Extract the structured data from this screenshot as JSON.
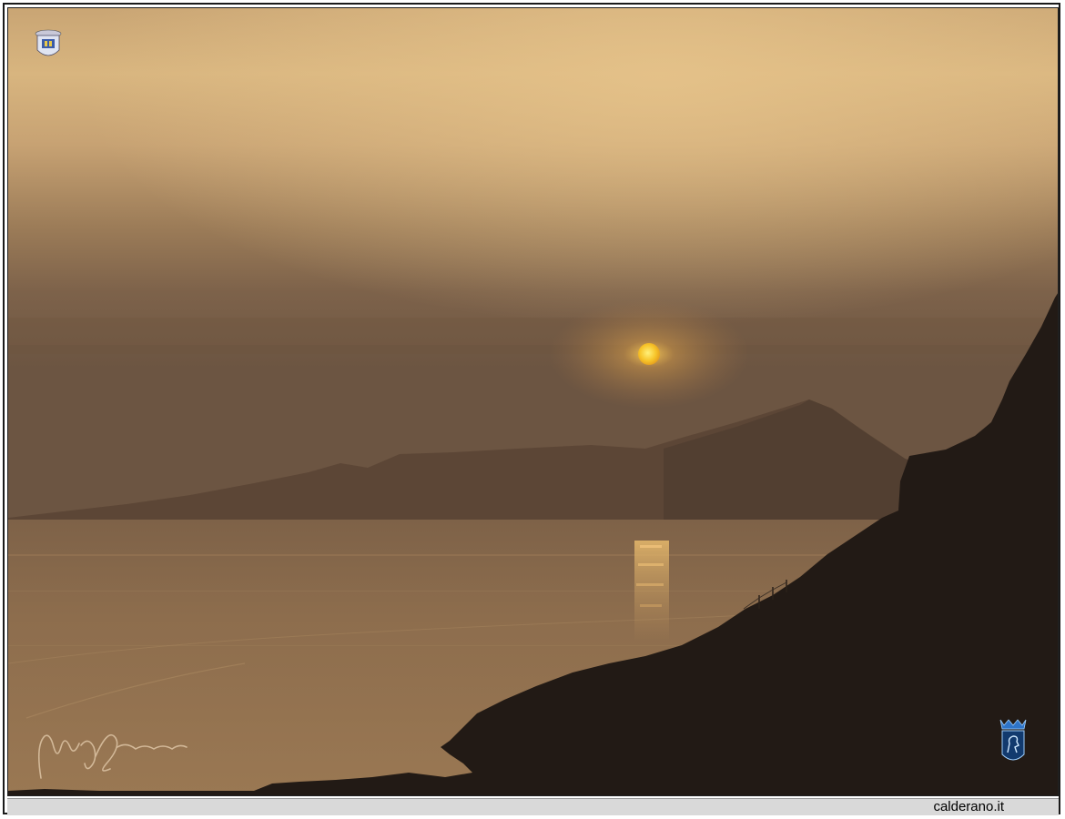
{
  "footer": {
    "site_label": "calderano.it"
  },
  "scene": {
    "description_tag": "sunset-over-sea",
    "colors": {
      "sky_top": "#d6b27f",
      "sky_bright": "#e2bf86",
      "sky_mid": "#a9865b",
      "sky_low": "#7a5f44",
      "haze": "#6e5641",
      "mountain_far": "#5a4434",
      "sea": "#8e6d4c",
      "sea_light": "#9c7a55",
      "sun": "#f5c22a",
      "reflection": "#c9a064",
      "cliff": "#221a15"
    },
    "icons": [
      "crest-logo-icon",
      "lion-shield-logo-icon",
      "signature-mark"
    ]
  }
}
